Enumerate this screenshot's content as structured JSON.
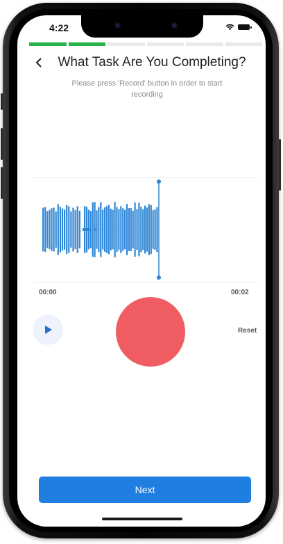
{
  "status_bar": {
    "time": "4:22",
    "wifi_icon": "wifi-icon",
    "battery_icon": "battery-icon"
  },
  "progress": {
    "segments_total": 6,
    "segments_done": 2,
    "done_color": "#27b24a"
  },
  "header": {
    "back_icon": "chevron-left-icon",
    "title": "What Task Are You Completing?",
    "subtitle": "Please press 'Record' button in order to start recording"
  },
  "recorder": {
    "waveform_color": "#2f86d6",
    "elapsed_time": "00:00",
    "total_time": "00:02",
    "play_icon": "play-icon",
    "record_color": "#ef5d63",
    "reset_label": "Reset"
  },
  "footer": {
    "next_label": "Next",
    "accent_color": "#1f7fe0"
  }
}
